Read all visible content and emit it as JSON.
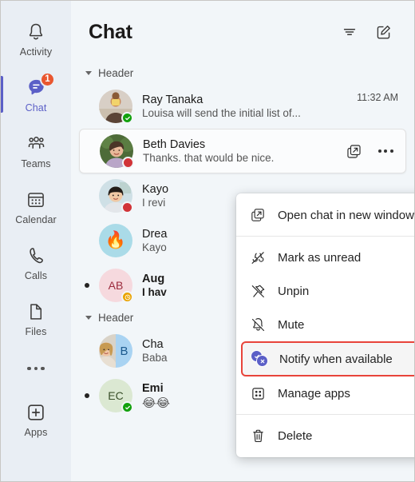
{
  "rail": {
    "items": [
      {
        "label": "Activity",
        "icon": "bell-icon",
        "active": false,
        "badge": null
      },
      {
        "label": "Chat",
        "icon": "chat-bubble-icon",
        "active": true,
        "badge": "1"
      },
      {
        "label": "Teams",
        "icon": "people-icon",
        "active": false,
        "badge": null
      },
      {
        "label": "Calendar",
        "icon": "calendar-icon",
        "active": false,
        "badge": null
      },
      {
        "label": "Calls",
        "icon": "phone-icon",
        "active": false,
        "badge": null
      },
      {
        "label": "Files",
        "icon": "file-icon",
        "active": false,
        "badge": null
      }
    ],
    "more_label": "More options",
    "apps": {
      "label": "Apps",
      "icon": "plus-box-icon"
    },
    "accent_color": "#5b5fc7",
    "badge_color": "#e9562f"
  },
  "header": {
    "title": "Chat",
    "filter_icon": "filter-icon",
    "compose_icon": "compose-new-chat-icon"
  },
  "list": {
    "group1": {
      "label": "Header",
      "rows": [
        {
          "name": "Ray Tanaka",
          "preview": "Louisa will send the initial list of...",
          "time": "11:32 AM",
          "presence": "available",
          "avatar_type": "photo-child-on-shoulders",
          "unread": false,
          "selected": false
        },
        {
          "name": "Beth Davies",
          "preview": "Thanks. that would be nice.",
          "time": "",
          "presence": "busy",
          "avatar_type": "photo-woman-garden",
          "unread": false,
          "selected": true,
          "actions": [
            "open-in-new-window-icon",
            "more-options-icon"
          ]
        },
        {
          "name": "Kayo",
          "preview": "I revi",
          "time": "",
          "presence": "busy",
          "avatar_type": "photo-woman-office",
          "unread": false,
          "selected": false
        },
        {
          "name": "Drea",
          "preview": "Kayo",
          "time": "",
          "presence": "none",
          "avatar_type": "emoji-fire",
          "avatar_emoji": "🔥",
          "avatar_bg": "#aadbe8",
          "unread": false,
          "selected": false
        },
        {
          "name": "Aug",
          "preview": "I hav",
          "time": "",
          "presence": "away",
          "avatar_type": "initials",
          "initials": "AB",
          "avatar_bg": "#f6d9de",
          "avatar_fg": "#9c2b3d",
          "unread": true,
          "selected": false
        }
      ]
    },
    "group2": {
      "label": "Header",
      "rows": [
        {
          "name": "Cha",
          "preview": "Baba",
          "time": "",
          "presence": "none",
          "avatar_type": "split-group",
          "initials": "B",
          "avatar_bg": "#a9d3f2",
          "avatar_fg": "#1b5a8e",
          "unread": false,
          "selected": false
        },
        {
          "name": "Emi",
          "preview": "😂😂",
          "time": "",
          "presence": "available",
          "avatar_type": "initials",
          "initials": "EC",
          "avatar_bg": "#dbe8d2",
          "avatar_fg": "#39502a",
          "unread": true,
          "selected": false
        }
      ]
    }
  },
  "context_menu": {
    "highlight_color": "#e8443a",
    "items": [
      {
        "label": "Open chat in new window",
        "icon": "open-in-new-window-icon",
        "highlighted": false,
        "separator_after": true
      },
      {
        "label": "Mark as unread",
        "icon": "mark-as-unread-icon",
        "highlighted": false,
        "separator_after": false
      },
      {
        "label": "Unpin",
        "icon": "unpin-icon",
        "highlighted": false,
        "separator_after": false
      },
      {
        "label": "Mute",
        "icon": "mute-bell-icon",
        "highlighted": false,
        "separator_after": false
      },
      {
        "label": "Notify when available",
        "icon": "notify-when-available-icon",
        "highlighted": true,
        "separator_after": false
      },
      {
        "label": "Manage apps",
        "icon": "manage-apps-icon",
        "highlighted": false,
        "separator_after": true
      },
      {
        "label": "Delete",
        "icon": "trash-icon",
        "highlighted": false,
        "separator_after": false
      }
    ]
  }
}
